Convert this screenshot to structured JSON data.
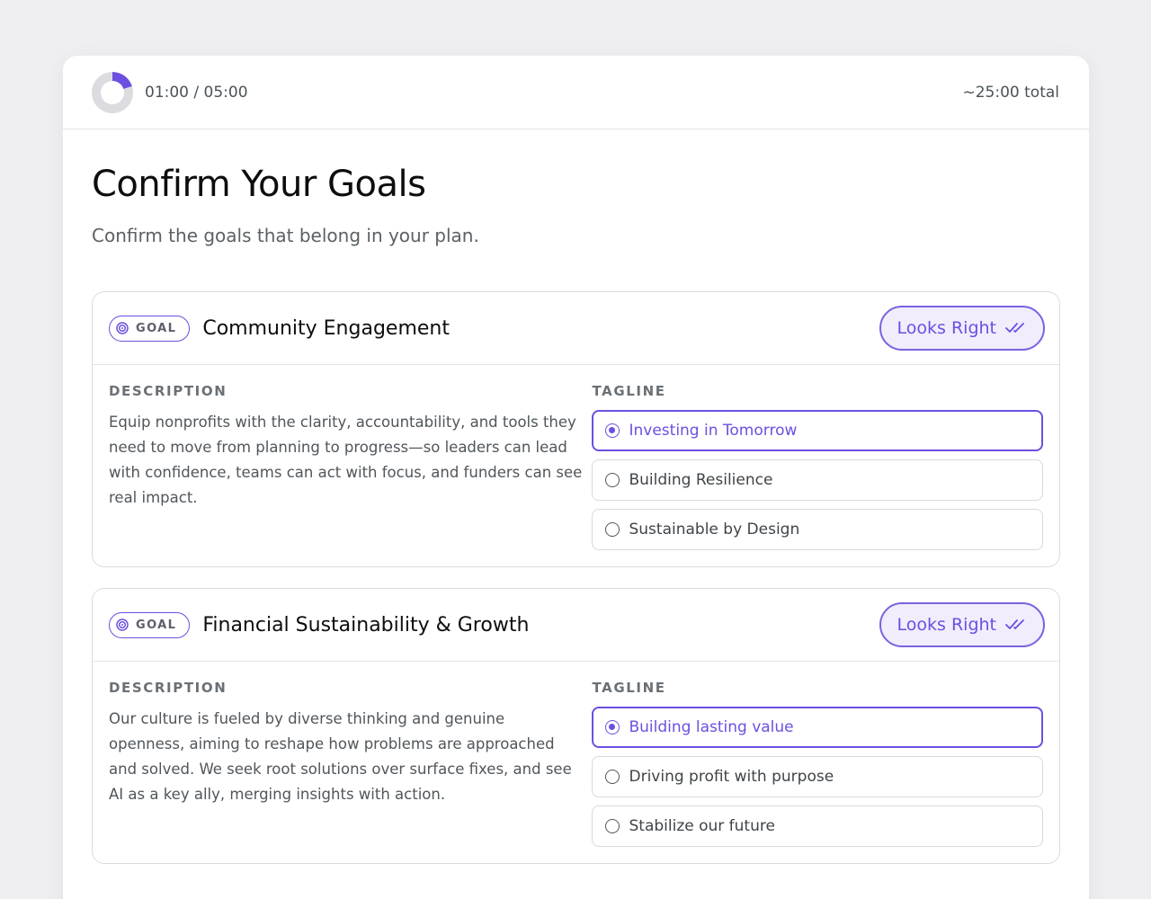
{
  "header": {
    "timer": "01:00 / 05:00",
    "timer_progress_fraction": 0.2,
    "total": "~25:00 total"
  },
  "page": {
    "title": "Confirm Your Goals",
    "subtitle": "Confirm the goals that belong in your plan."
  },
  "labels": {
    "badge": "GOAL",
    "description": "DESCRIPTION",
    "tagline": "TAGLINE",
    "looks_right": "Looks Right"
  },
  "colors": {
    "accent": "#6d4fe0",
    "accent_light": "#f1edfd"
  },
  "goals": [
    {
      "title": "Community Engagement",
      "description": "Equip nonprofits with the clarity, accountability, and tools they need to move from planning to progress—so leaders can lead with confidence, teams can act with focus, and funders can see real impact.",
      "taglines": [
        "Investing in Tomorrow",
        "Building Resilience",
        "Sustainable by Design"
      ],
      "selected_tagline": 0
    },
    {
      "title": "Financial Sustainability & Growth",
      "description": "Our culture is fueled by diverse thinking and genuine openness, aiming to reshape how problems are approached and solved. We seek root solutions over surface fixes, and see AI as a key ally, merging insights with action.",
      "taglines": [
        "Building lasting value",
        "Driving profit with purpose",
        "Stabilize our future"
      ],
      "selected_tagline": 0
    }
  ]
}
